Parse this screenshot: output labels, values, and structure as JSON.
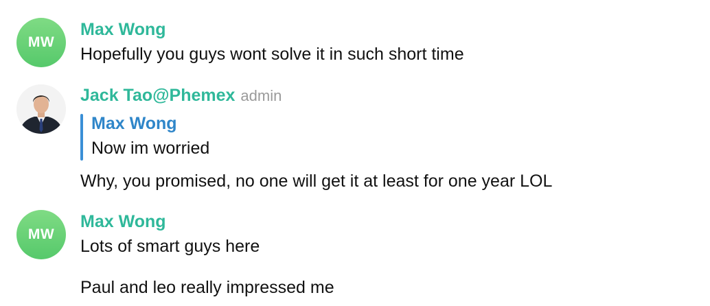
{
  "messages": [
    {
      "avatar_initials": "MW",
      "sender": "Max Wong",
      "text": "Hopefully you guys wont solve it in such short time"
    },
    {
      "sender": "Jack Tao@Phemex",
      "role": "admin",
      "reply": {
        "sender": "Max Wong",
        "text": "Now im worried"
      },
      "text": "Why, you promised, no one will get it at least for one year LOL"
    },
    {
      "avatar_initials": "MW",
      "sender": "Max Wong",
      "texts": [
        "Lots of smart guys here",
        "Paul and leo really impressed me"
      ]
    }
  ],
  "colors": {
    "sender_name": "#2fb89a",
    "reply_accent": "#3a8fd6",
    "reply_name": "#2f86c9",
    "role_text": "#9a9a9a",
    "avatar_green": "#5fce72"
  }
}
